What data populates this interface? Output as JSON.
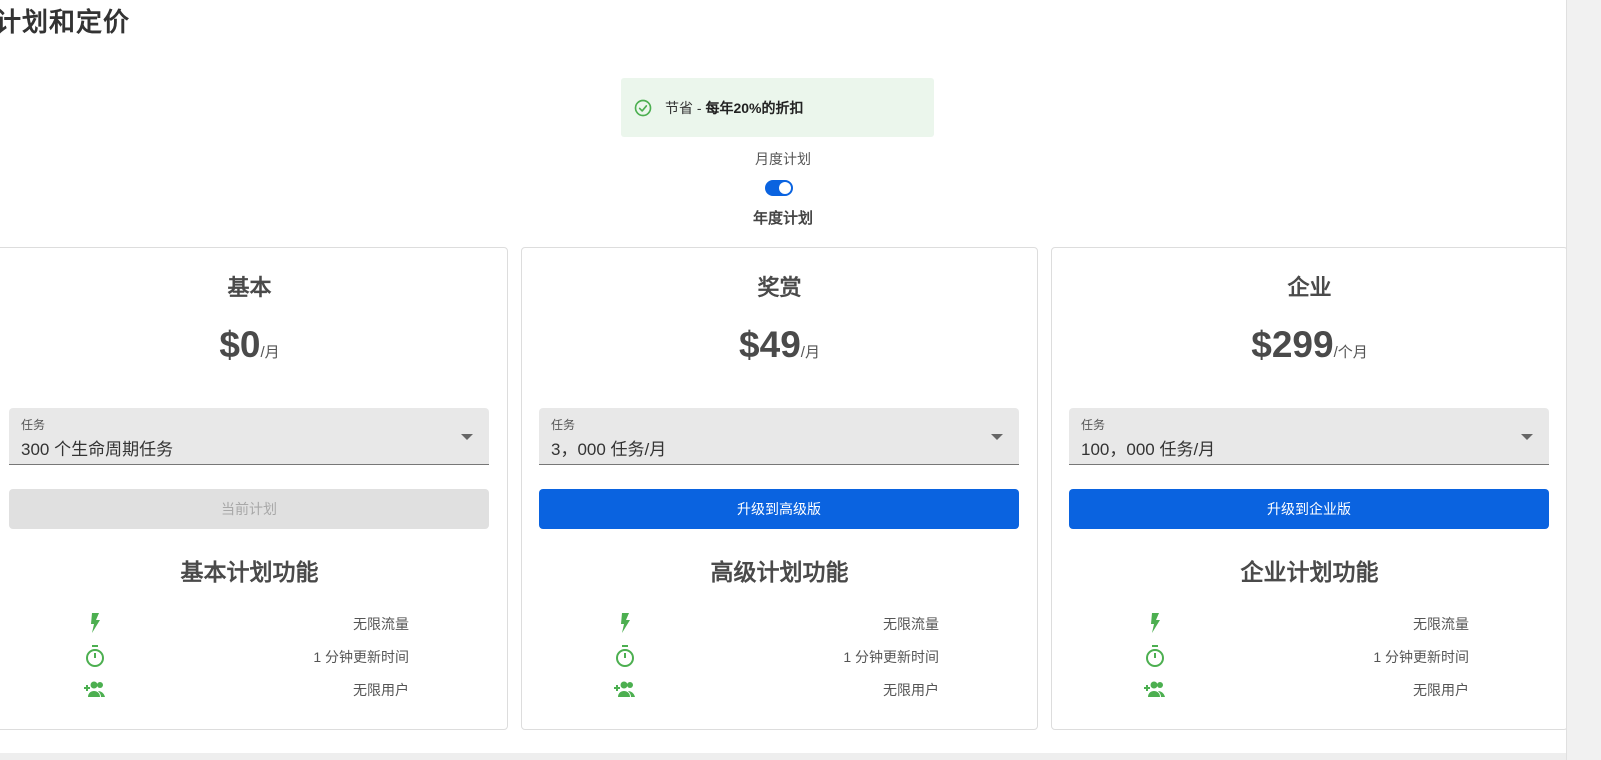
{
  "page": {
    "title": "计划和定价"
  },
  "savings_banner": {
    "prefix": "节省 - ",
    "highlight": "每年20%的折扣",
    "icon": "check-circle-icon"
  },
  "billing": {
    "monthly_label": "月度计划",
    "yearly_label": "年度计划",
    "yearly_selected": true
  },
  "colors": {
    "primary": "#0a63e0",
    "feature_icon": "#4caf50",
    "banner_bg": "#ebf6ec"
  },
  "plans": [
    {
      "name": "基本",
      "price": "$0",
      "unit": "/月",
      "select_label": "任务",
      "select_value": "300 个生命周期任务",
      "button": "当前计划",
      "button_type": "current",
      "features_title": "基本计划功能",
      "features": [
        {
          "icon": "bolt-icon",
          "text": "无限流量"
        },
        {
          "icon": "timer-icon",
          "text": "1 分钟更新时间"
        },
        {
          "icon": "add-users-icon",
          "text": "无限用户"
        }
      ]
    },
    {
      "name": "奖赏",
      "price": "$49",
      "unit": "/月",
      "select_label": "任务",
      "select_value": "3，000 任务/月",
      "button": "升级到高级版",
      "button_type": "primary",
      "features_title": "高级计划功能",
      "features": [
        {
          "icon": "bolt-icon",
          "text": "无限流量"
        },
        {
          "icon": "timer-icon",
          "text": "1 分钟更新时间"
        },
        {
          "icon": "add-users-icon",
          "text": "无限用户"
        }
      ]
    },
    {
      "name": "企业",
      "price": "$299",
      "unit": "/个月",
      "select_label": "任务",
      "select_value": "100，000 任务/月",
      "button": "升级到企业版",
      "button_type": "primary",
      "features_title": "企业计划功能",
      "features": [
        {
          "icon": "bolt-icon",
          "text": "无限流量"
        },
        {
          "icon": "timer-icon",
          "text": "1 分钟更新时间"
        },
        {
          "icon": "add-users-icon",
          "text": "无限用户"
        }
      ]
    }
  ]
}
